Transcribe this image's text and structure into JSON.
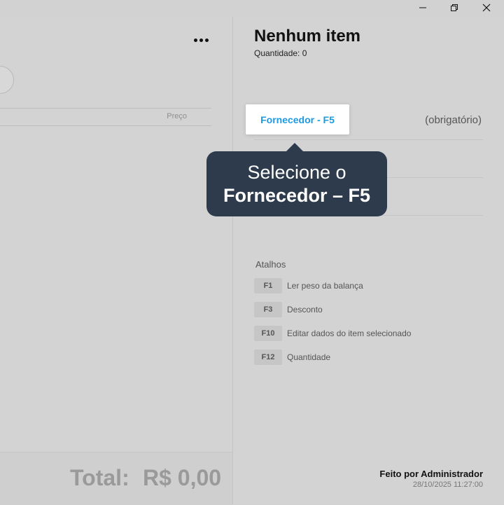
{
  "window": {
    "minimize_icon": "minimize-icon",
    "maximize_icon": "restore-icon",
    "close_icon": "close-icon"
  },
  "left": {
    "more_icon": "more-horizontal-icon",
    "table": {
      "price_header": "Preço"
    },
    "total": {
      "label": "Total:",
      "value": "R$ 0,00"
    }
  },
  "right": {
    "title": "Nenhum item",
    "quantity_text": "Quantidade: 0",
    "supplier": {
      "button_label": "Fornecedor - F5",
      "required_text": "(obrigatório)"
    },
    "tooltip": {
      "line1": "Selecione o",
      "line2": "Fornecedor – F5"
    },
    "shortcuts": {
      "title": "Atalhos",
      "items": [
        {
          "key": "F1",
          "label": "Ler peso da balança"
        },
        {
          "key": "F3",
          "label": "Desconto"
        },
        {
          "key": "F10",
          "label": "Editar dados do item selecionado"
        },
        {
          "key": "F12",
          "label": "Quantidade"
        }
      ]
    },
    "footer": {
      "made_by": "Feito por Administrador",
      "datetime": "28/10/2025 11:27:00"
    }
  },
  "colors": {
    "accent": "#1e9ae0",
    "tooltip_bg": "#2d3b4c",
    "background": "#d3d3d3"
  }
}
